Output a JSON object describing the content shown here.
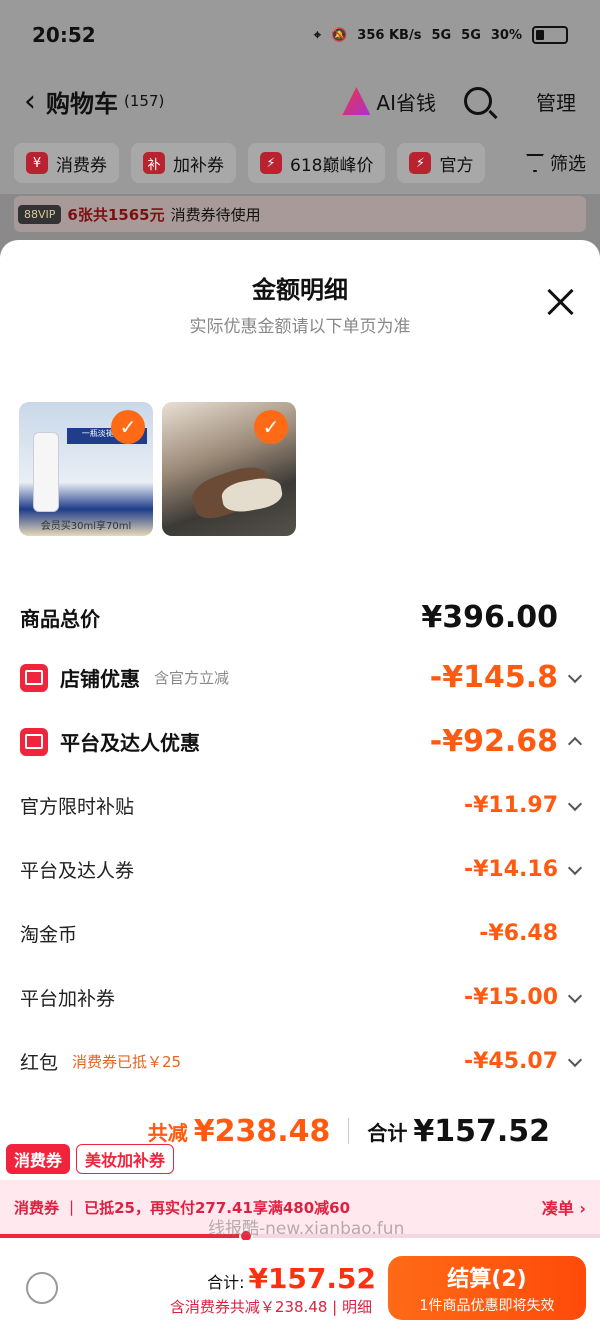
{
  "status_bar": {
    "time": "20:52",
    "net_speed": "356 KB/s",
    "signal1": "5G",
    "signal2": "5G",
    "battery": "30%"
  },
  "cart_header": {
    "title": "购物车",
    "count": "(157)",
    "ai_label": "AI省钱",
    "manage": "管理"
  },
  "filters": [
    {
      "icon": "¥",
      "label": "消费券"
    },
    {
      "icon": "补",
      "label": "加补券"
    },
    {
      "icon": "⚡",
      "label": "618巅峰价"
    },
    {
      "icon": "⚡",
      "label": "官方"
    }
  ],
  "filter_button": "筛选",
  "vip_banner": {
    "tag": "88VIP",
    "strong": "6张共1565元",
    "text": "消费券待使用"
  },
  "sheet": {
    "title": "金额明细",
    "subtitle": "实际优惠金额请以下单页为准",
    "thumb1_caption": "会员买30ml享70ml",
    "thumb1_box": "一瓶淡褪 斑点"
  },
  "rows": {
    "goods_total": {
      "label": "商品总价",
      "value": "¥396.00"
    },
    "shop_discount": {
      "label": "店铺优惠",
      "sub": "含官方立减",
      "value": "-¥145.8"
    },
    "platform_discount": {
      "label": "平台及达人优惠",
      "value": "-¥92.68"
    },
    "official_subsidy": {
      "label": "官方限时补贴",
      "value": "-¥11.97"
    },
    "platform_coupon": {
      "label": "平台及达人券",
      "value": "-¥14.16"
    },
    "tao_coin": {
      "label": "淘金币",
      "value": "-¥6.48"
    },
    "platform_bonus": {
      "label": "平台加补券",
      "value": "-¥15.00"
    },
    "red_packet": {
      "label": "红包",
      "sub": "消费券已抵￥25",
      "value": "-¥45.07"
    }
  },
  "totals": {
    "reduce_label": "共减",
    "reduce_value": "¥238.48",
    "sum_label": "合计",
    "sum_value": "¥157.52"
  },
  "tags": {
    "t1": "消费券",
    "t2": "美妆加补券"
  },
  "promo": {
    "label": "消费券",
    "text": "已抵25，再实付277.41享满480减60",
    "go": "凑单 ›",
    "progress": 0.41
  },
  "watermark": "线报酷-new.xianbao.fun",
  "bottom": {
    "total_label": "合计:",
    "total_value": "¥157.52",
    "detail": "含消费券共减￥238.48 | 明细",
    "checkout": "结算(2)",
    "checkout_sub": "1件商品优惠即将失效"
  },
  "colors": {
    "accent": "#ff5a10",
    "red": "#f0243c"
  }
}
